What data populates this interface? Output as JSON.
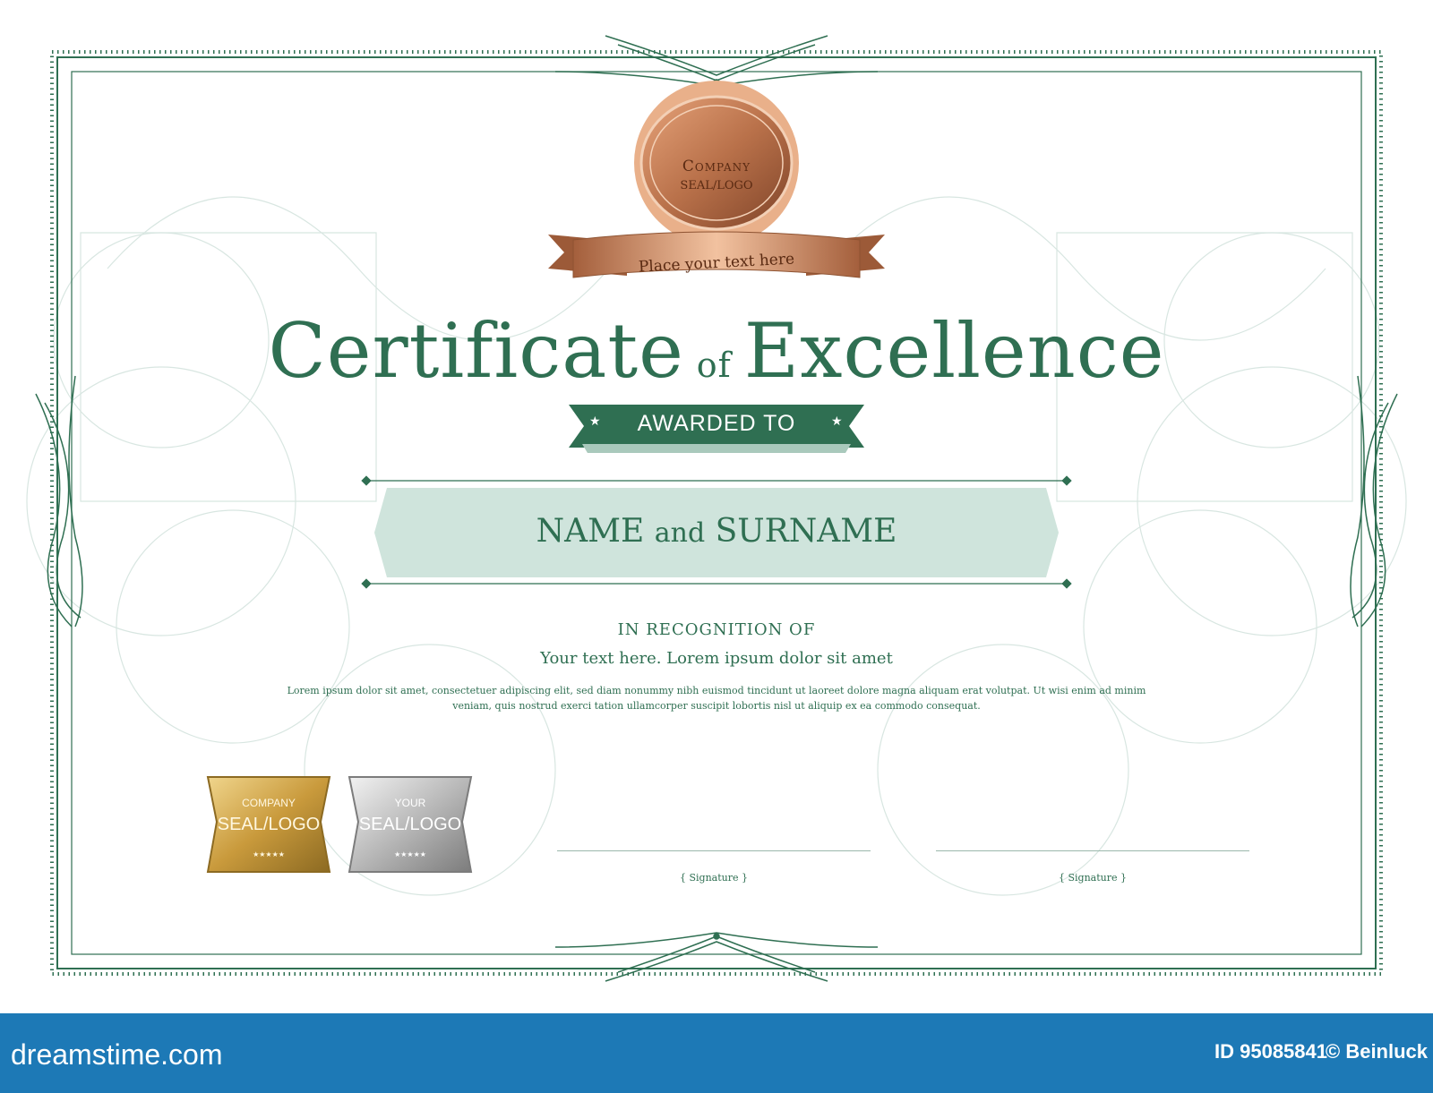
{
  "certificate": {
    "seal": {
      "line1": "Company",
      "line2": "SEAL/LOGO"
    },
    "ribbon_text": "Place your text here",
    "title": {
      "word1": "Certificate",
      "connector": "of",
      "word2": "Excellence"
    },
    "awarded_to": "AWARDED TO",
    "name": {
      "first": "NAME",
      "connector": "and",
      "last": "SURNAME"
    },
    "recognition_label": "IN RECOGNITION OF",
    "recognition_text": "Your text here. Lorem ipsum dolor sit amet",
    "body_text": "Lorem ipsum dolor sit amet, consectetuer adipiscing elit, sed diam nonummy nibh euismod tincidunt ut laoreet dolore magna aliquam erat volutpat. Ut wisi enim ad minim veniam, quis nostrud exerci tation ullamcorper suscipit lobortis nisl ut aliquip ex ea commodo consequat.",
    "badges": [
      {
        "line1": "COMPANY",
        "line2": "SEAL/LOGO",
        "stars": "★★★★★"
      },
      {
        "line1": "YOUR",
        "line2": "SEAL/LOGO",
        "stars": "★★★★★"
      }
    ],
    "signatures": [
      "{ Signature }",
      "{ Signature }"
    ]
  },
  "footer": {
    "site": "dreamstime.com",
    "id_label": "ID 95085841",
    "copyright": "© Beinluck"
  },
  "colors": {
    "green": "#2f6f52",
    "light_green": "#cfe4dc",
    "bronze": "#b9714a",
    "footer_blue": "#1d79b6"
  }
}
